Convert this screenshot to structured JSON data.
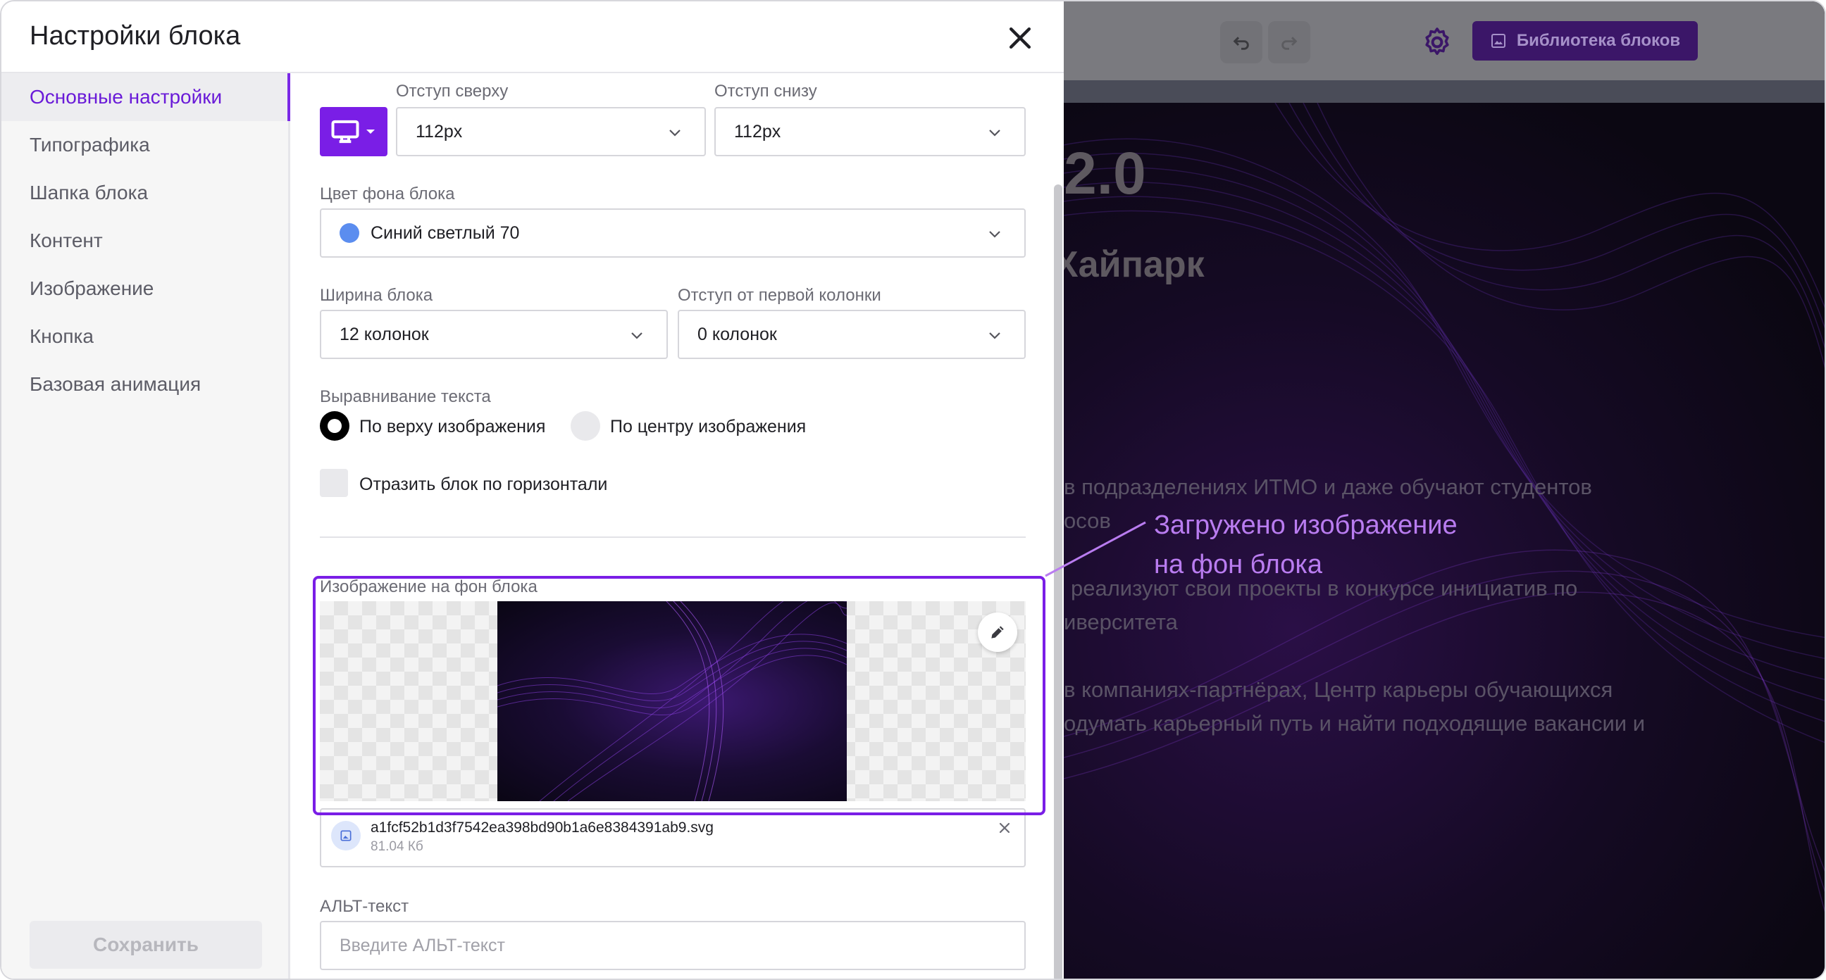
{
  "modal": {
    "title": "Настройки блока",
    "save_label": "Сохранить"
  },
  "sidebar": {
    "items": [
      {
        "label": "Основные настройки",
        "active": true
      },
      {
        "label": "Типографика",
        "active": false
      },
      {
        "label": "Шапка блока",
        "active": false
      },
      {
        "label": "Контент",
        "active": false
      },
      {
        "label": "Изображение",
        "active": false
      },
      {
        "label": "Кнопка",
        "active": false
      },
      {
        "label": "Базовая анимация",
        "active": false
      }
    ]
  },
  "form": {
    "device_icon": "monitor-icon",
    "padding_top": {
      "label": "Отступ сверху",
      "value": "112px"
    },
    "padding_bottom": {
      "label": "Отступ снизу",
      "value": "112px"
    },
    "bg_color": {
      "label": "Цвет фона блока",
      "value": "Синий светлый 70",
      "swatch": "#5b8def"
    },
    "block_width": {
      "label": "Ширина блока",
      "value": "12 колонок"
    },
    "first_col_offset": {
      "label": "Отступ от первой колонки",
      "value": "0 колонок"
    },
    "text_align": {
      "label": "Выравнивание текста",
      "options": [
        {
          "label": "По верху изображения",
          "selected": true
        },
        {
          "label": "По центру изображения",
          "selected": false
        }
      ]
    },
    "mirror": {
      "label": "Отразить блок по горизонтали",
      "checked": false
    },
    "bg_image": {
      "label": "Изображение на фон блока",
      "file_name": "a1fcf52b1d3f7542ea398bd90b1a6e8384391ab9.svg",
      "file_size": "81.04 Кб"
    },
    "alt": {
      "label": "АЛЬТ-текст",
      "placeholder": "Введите АЛЬТ-текст",
      "value": ""
    }
  },
  "editor": {
    "library_label": "Библиотека блоков",
    "heading_fragment": "2.0",
    "subheading_fragment": "Хайпарк",
    "text_lines": [
      "в подразделениях ИТМО и даже обучают студентов",
      "осов",
      "реализуют свои проекты в конкурсе инициатив по",
      "иверситета",
      "в компаниях-партнёрах, Центр карьеры обучающихся",
      "одумать карьерный путь и найти подходящие вакансии и"
    ]
  },
  "annotation": {
    "line1": "Загружено изображение",
    "line2": "на фон блока"
  },
  "colors": {
    "accent": "#7a1ee6",
    "annotation": "#b97cf0"
  }
}
